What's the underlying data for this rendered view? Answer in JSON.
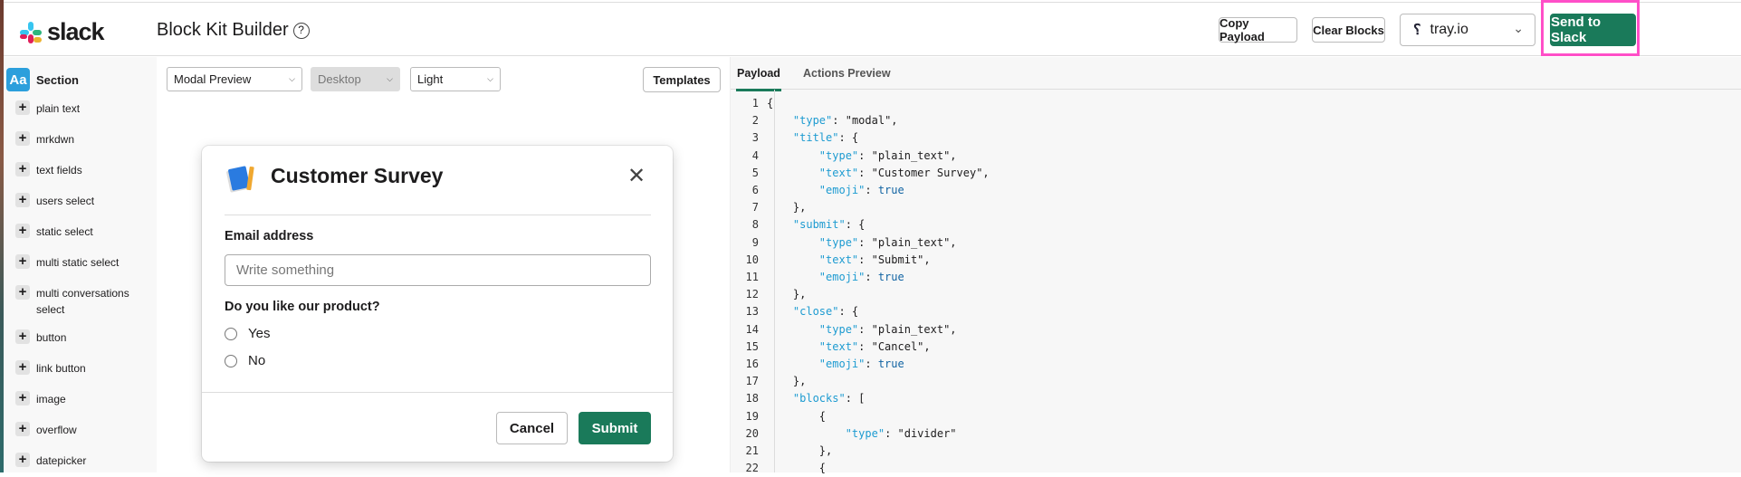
{
  "header": {
    "brand": "slack",
    "title": "Block Kit Builder",
    "help": "?",
    "copy_payload": "Copy Payload",
    "clear_blocks": "Clear Blocks",
    "workspace": "tray.io",
    "send": "Send to Slack"
  },
  "sidebar": {
    "section": "Section",
    "section_icon": "Aa",
    "items": [
      "plain text",
      "mrkdwn",
      "text fields",
      "users select",
      "static select",
      "multi static select",
      "multi conversations select",
      "button",
      "link button",
      "image",
      "overflow",
      "datepicker"
    ]
  },
  "preview": {
    "mode": "Modal Preview",
    "device": "Desktop",
    "theme": "Light",
    "templates": "Templates"
  },
  "modal": {
    "title": "Customer Survey",
    "email_label": "Email address",
    "email_placeholder": "Write something",
    "question": "Do you like our product?",
    "options": [
      "Yes",
      "No"
    ],
    "cancel": "Cancel",
    "submit": "Submit"
  },
  "payload": {
    "tabs": [
      "Payload",
      "Actions Preview"
    ],
    "lines": [
      "{",
      "    \"type\": \"modal\",",
      "    \"title\": {",
      "        \"type\": \"plain_text\",",
      "        \"text\": \"Customer Survey\",",
      "        \"emoji\": true",
      "    },",
      "    \"submit\": {",
      "        \"type\": \"plain_text\",",
      "        \"text\": \"Submit\",",
      "        \"emoji\": true",
      "    },",
      "    \"close\": {",
      "        \"type\": \"plain_text\",",
      "        \"text\": \"Cancel\",",
      "        \"emoji\": true",
      "    },",
      "    \"blocks\": [",
      "        {",
      "            \"type\": \"divider\"",
      "        },",
      "        {"
    ]
  },
  "colors": {
    "accent": "#1a7a5a",
    "highlight": "#ff4fc8",
    "key": "#1d9bd1"
  }
}
